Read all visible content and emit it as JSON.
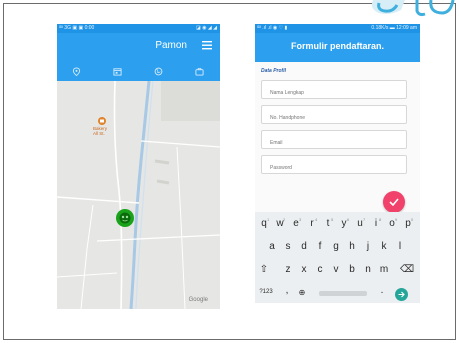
{
  "left_phone": {
    "status_left": "ᴵᴰᴵ 3G ▣ ▣ 0:00",
    "status_right": "◪ ◉ ◢ ◢",
    "app_title": "Pamon",
    "menu_icon": "hamburger-menu-icon",
    "tabs": [
      {
        "icon": "map-pin-icon"
      },
      {
        "icon": "calendar-icon"
      },
      {
        "icon": "globe-icon"
      },
      {
        "icon": "briefcase-icon"
      }
    ],
    "map": {
      "poi_label_line1": "Bakery",
      "poi_label_line2": "All St.",
      "google_logo": "Google",
      "poi_color": "#e0832a",
      "marker_color": "#1aa31a"
    }
  },
  "right_phone": {
    "status_left": "ᴵᴰᴵ .ıl .ıl ◉ ♡ ▮",
    "status_right": "0.18K/s ▬ 12:09 am",
    "app_title": "Formulir pendaftaran.",
    "section_label": "Data Profil",
    "fields": [
      {
        "placeholder": "Nama Lengkap"
      },
      {
        "placeholder": "No. Handphone"
      },
      {
        "placeholder": "Email"
      },
      {
        "placeholder": "Password"
      }
    ],
    "fab_icon": "check-icon",
    "fab_color": "#f0426a",
    "keyboard": {
      "row1": [
        "q",
        "w",
        "e",
        "r",
        "t",
        "y",
        "u",
        "i",
        "o",
        "p"
      ],
      "row1_nums": [
        "1",
        "2",
        "3",
        "4",
        "5",
        "6",
        "7",
        "8",
        "9",
        "0"
      ],
      "row2": [
        "a",
        "s",
        "d",
        "f",
        "g",
        "h",
        "j",
        "k",
        "l"
      ],
      "row3_shift": "⇧",
      "row3": [
        "z",
        "x",
        "c",
        "v",
        "b",
        "n",
        "m"
      ],
      "row3_backspace": "⌫",
      "row4_symbols": "?123",
      "row4_comma": ",",
      "row4_globe": "⊕",
      "row4_period": ".",
      "enter_icon": "arrow-right-icon",
      "enter_color": "#26a69a"
    }
  },
  "colors": {
    "app_bar": "#2c9fee",
    "status_bar": "#1f94e6",
    "frame_border": "#6b6b6b"
  }
}
